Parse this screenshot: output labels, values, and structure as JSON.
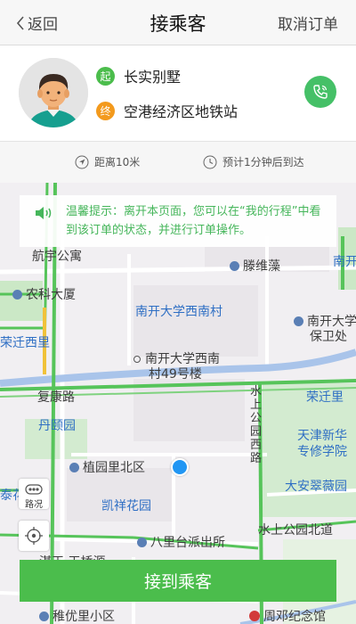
{
  "header": {
    "back_label": "返回",
    "title": "接乘客",
    "cancel_label": "取消订单"
  },
  "trip": {
    "start_badge": "起",
    "start": "长实别墅",
    "end_badge": "终",
    "end": "空港经济区地铁站"
  },
  "info": {
    "distance": "距离10米",
    "eta": "预计1分钟后到达"
  },
  "notice": {
    "text": "温馨提示：离开本页面，您可以在“我的行程”中看到该订单的状态，并进行订单操作。"
  },
  "map": {
    "labels": {
      "hangyu": "航宇公寓",
      "tengweizao": "滕维藻",
      "nankai_top": "南开",
      "nongke": "农科大厦",
      "nankai_xn": "南开大学西南村",
      "nankai_bwk_1": "南开大学",
      "nankai_bwk_2": "保卫处",
      "rongqianxili": "荣迁西里",
      "bldg_1": "南开大学西南",
      "bldg_2": "村49号楼",
      "fukang": "复康路",
      "rongqianli": "荣迁里",
      "danyiyuan": "丹颐园",
      "tj_1": "天津新华",
      "tj_2": "专修学院",
      "shuishang_road": "水上公园西路",
      "zhiyuan": "植园里北区",
      "daanzhai": "大安翠薇园",
      "taihua": "泰花",
      "kaixiang": "凯祥花园",
      "shuishang_n": "水上公园北道",
      "balitai": "八里台派出所",
      "chiyou": "稚优里小区",
      "zhouden": "周邓纪念馆",
      "partial": "湛王 玉桥源"
    }
  },
  "controls": {
    "traffic_label": "路况"
  },
  "actions": {
    "pickup_label": "接到乘客"
  }
}
